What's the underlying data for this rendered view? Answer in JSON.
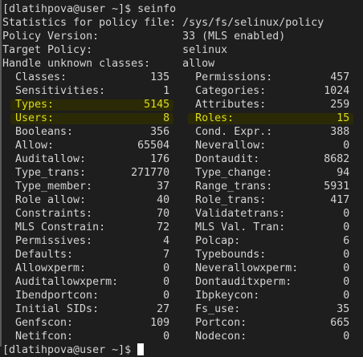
{
  "prompt": "[dlatihpova@user ~]$ ",
  "command": "seinfo",
  "header": [
    {
      "label": "Statistics for policy file: ",
      "value": "/sys/fs/selinux/policy"
    },
    {
      "label": "Policy Version:",
      "value": "33 (MLS enabled)"
    },
    {
      "label": "Target Policy:",
      "value": "selinux"
    },
    {
      "label": "Handle unknown classes:",
      "value": "allow"
    }
  ],
  "highlight_color": "#dcdc1e",
  "rows": [
    {
      "l": "Classes:",
      "lv": "135",
      "r": "Permissions:",
      "rv": "457"
    },
    {
      "l": "Sensitivities:",
      "lv": "1",
      "r": "Categories:",
      "rv": "1024"
    },
    {
      "l": "Types:",
      "lv": "5145",
      "r": "Attributes:",
      "rv": "259",
      "hl_left": true
    },
    {
      "l": "Users:",
      "lv": "8",
      "r": "Roles:",
      "rv": "15",
      "hl_left": true,
      "hl_right": true
    },
    {
      "l": "Booleans:",
      "lv": "356",
      "r": "Cond. Expr.:",
      "rv": "388"
    },
    {
      "l": "Allow:",
      "lv": "65504",
      "r": "Neverallow:",
      "rv": "0"
    },
    {
      "l": "Auditallow:",
      "lv": "176",
      "r": "Dontaudit:",
      "rv": "8682"
    },
    {
      "l": "Type_trans:",
      "lv": "271770",
      "r": "Type_change:",
      "rv": "94"
    },
    {
      "l": "Type_member:",
      "lv": "37",
      "r": "Range_trans:",
      "rv": "5931"
    },
    {
      "l": "Role allow:",
      "lv": "40",
      "r": "Role_trans:",
      "rv": "417"
    },
    {
      "l": "Constraints:",
      "lv": "70",
      "r": "Validatetrans:",
      "rv": "0"
    },
    {
      "l": "MLS Constrain:",
      "lv": "72",
      "r": "MLS Val. Tran:",
      "rv": "0"
    },
    {
      "l": "Permissives:",
      "lv": "4",
      "r": "Polcap:",
      "rv": "6"
    },
    {
      "l": "Defaults:",
      "lv": "7",
      "r": "Typebounds:",
      "rv": "0"
    },
    {
      "l": "Allowxperm:",
      "lv": "0",
      "r": "Neverallowxperm:",
      "rv": "0"
    },
    {
      "l": "Auditallowxperm:",
      "lv": "0",
      "r": "Dontauditxperm:",
      "rv": "0"
    },
    {
      "l": "Ibendportcon:",
      "lv": "0",
      "r": "Ibpkeycon:",
      "rv": "0"
    },
    {
      "l": "Initial SIDs:",
      "lv": "27",
      "r": "Fs_use:",
      "rv": "35"
    },
    {
      "l": "Genfscon:",
      "lv": "109",
      "r": "Portcon:",
      "rv": "665"
    },
    {
      "l": "Netifcon:",
      "lv": "0",
      "r": "Nodecon:",
      "rv": "0"
    }
  ]
}
